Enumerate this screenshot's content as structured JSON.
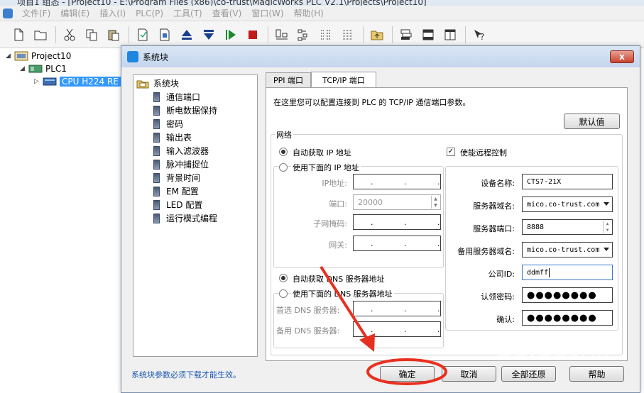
{
  "app": {
    "title": "项目1 组态 - [Project10 - E:\\Program Files (x86)\\co-trust\\MagicWorks PLC V2.1\\Projects\\Project10]",
    "menu": [
      "文件(F)",
      "编辑(E)",
      "插入(I)",
      "PLC(P)",
      "工具(T)",
      "查看(V)",
      "窗口(W)",
      "帮助(H)"
    ]
  },
  "toolbar_icons": [
    "new-file-icon",
    "open-folder-icon",
    "cut-icon",
    "copy-icon",
    "paste-icon",
    "edit-doc-icon",
    "edit-doc2-icon",
    "upload-icon",
    "download-icon",
    "run-icon",
    "stop-icon",
    "view1-icon",
    "view2-icon",
    "view3-icon",
    "view4-icon",
    "folder-up-icon",
    "layout1-icon",
    "layout2-icon",
    "layout3-icon",
    "help-icon"
  ],
  "tree": {
    "project": "Project10",
    "plc": "PLC1",
    "cpu": "CPU H224 RE"
  },
  "dialog": {
    "title": "系统块",
    "close_label": "x",
    "side": {
      "root": "系统块",
      "items": [
        "通信端口",
        "断电数据保持",
        "密码",
        "输出表",
        "输入滤波器",
        "脉冲捕捉位",
        "背景时间",
        "EM 配置",
        "LED 配置",
        "运行模式编程"
      ]
    },
    "tabs": [
      "PPI 端口",
      "TCP/IP 端口"
    ],
    "active_tab": 1,
    "intro": "在这里您可以配置连接到 PLC 的 TCP/IP 通信端口参数。",
    "default_button": "默认值",
    "network": {
      "group_label": "网络",
      "auto_ip": "自动获取 IP 地址",
      "manual_ip": "使用下面的 IP 地址",
      "ip_label": "IP地址:",
      "ip_value": ". . .",
      "port_label": "端口:",
      "port_value": "20000",
      "mask_label": "子网掩码:",
      "mask_value": ". . .",
      "gateway_label": "网关:",
      "gateway_value": ". . .",
      "auto_dns": "自动获取 DNS 服务器地址",
      "manual_dns": "使用下面的 DNS 服务器地址",
      "dns1_label": "首选 DNS 服务器:",
      "dns1_value": ". . .",
      "dns2_label": "备用 DNS 服务器:",
      "dns2_value": ". . ."
    },
    "remote": {
      "enable_label": "使能远程控制",
      "enable_checked": true,
      "device_label": "设备名称:",
      "device_value": "CTS7-21X",
      "server_domain_label": "服务器域名:",
      "server_domain_value": "mico.co-trust.com",
      "server_port_label": "服务器端口:",
      "server_port_value": "8888",
      "backup_domain_label": "备用服务器域名:",
      "backup_domain_value": "mico.co-trust.com",
      "company_label": "公司ID:",
      "company_value": "ddmff",
      "password_label": "认领密码:",
      "password_value": "●●●●●●●●",
      "confirm_label": "确认:",
      "confirm_value": "●●●●●●●●"
    },
    "note": "系统块参数必须下载才能生效。",
    "buttons": {
      "ok": "确定",
      "cancel": "取消",
      "restore_all": "全部还原",
      "help": "帮助"
    }
  },
  "annotation": {
    "arrow_color": "#e83020",
    "circle_color": "#e83020"
  },
  "watermark": "Baidu经验"
}
